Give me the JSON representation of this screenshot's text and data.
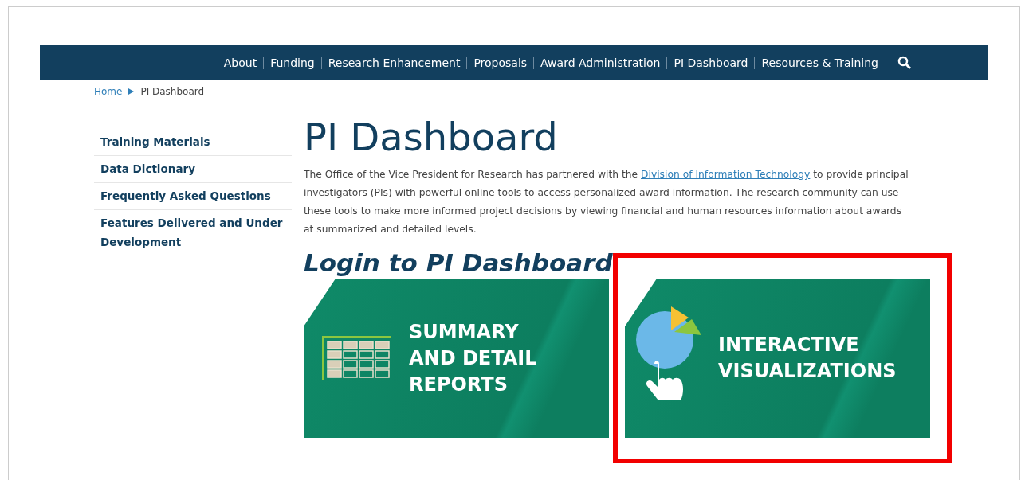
{
  "nav": {
    "items": [
      "About",
      "Funding",
      "Research Enhancement",
      "Proposals",
      "Award Administration",
      "PI Dashboard",
      "Resources & Training"
    ]
  },
  "breadcrumb": {
    "items": [
      "Home",
      "PI Dashboard"
    ]
  },
  "sidebar": {
    "items": [
      "Training Materials",
      "Data Dictionary",
      "Frequently Asked Questions",
      "Features Delivered and Under Development"
    ]
  },
  "title": "PI Dashboard",
  "intro": {
    "before": "The Office of the Vice President for Research has partnered with the ",
    "link": "Division of Information Technology",
    "after": " to provide principal investigators (PIs) with powerful online tools to access personalized award information. The research community can use these tools to make more informed project decisions by viewing financial and human resources information about awards at summarized and detailed levels."
  },
  "login_heading": "Login to PI Dashboard",
  "tiles": [
    {
      "kind": "reports",
      "lines": [
        "SUMMARY",
        "AND DETAIL",
        "REPORTS"
      ],
      "highlighted": false
    },
    {
      "kind": "visualizations",
      "lines": [
        "INTERACTIVE",
        "VISUALIZATIONS"
      ],
      "highlighted": true
    }
  ]
}
